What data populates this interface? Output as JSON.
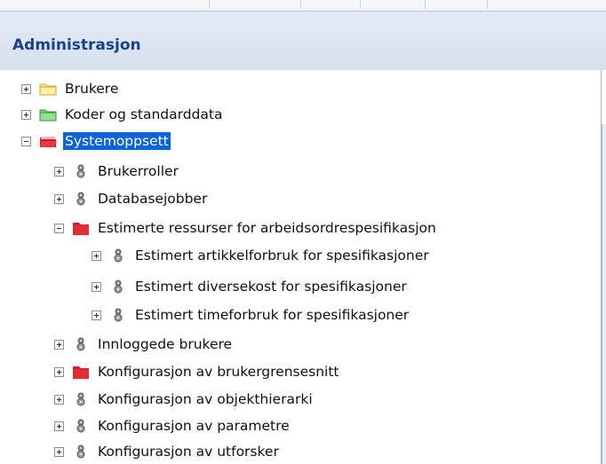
{
  "header": {
    "title": "Administrasjon"
  },
  "tree": {
    "items": [
      {
        "label": "Brukere",
        "state": "collapsed",
        "icon": "folder-yellow-icon"
      },
      {
        "label": "Koder og standarddata",
        "state": "collapsed",
        "icon": "folder-green-icon"
      },
      {
        "label": "Systemoppsett",
        "state": "expanded",
        "icon": "folder-red-open-icon",
        "selected": true
      },
      {
        "label": "Brukerroller",
        "state": "collapsed",
        "icon": "gear-icon"
      },
      {
        "label": "Databasejobber",
        "state": "collapsed",
        "icon": "gear-icon"
      },
      {
        "label": "Estimerte ressurser for arbeidsordrespesifikasjon",
        "state": "expanded",
        "icon": "folder-red-icon"
      },
      {
        "label": "Estimert artikkelforbruk for spesifikasjoner",
        "state": "collapsed",
        "icon": "gear-icon"
      },
      {
        "label": "Estimert diversekost for spesifikasjoner",
        "state": "collapsed",
        "icon": "gear-icon"
      },
      {
        "label": "Estimert timeforbruk for spesifikasjoner",
        "state": "collapsed",
        "icon": "gear-icon"
      },
      {
        "label": "Innloggede brukere",
        "state": "collapsed",
        "icon": "gear-icon"
      },
      {
        "label": "Konfigurasjon av brukergrensesnitt",
        "state": "collapsed",
        "icon": "folder-red-icon"
      },
      {
        "label": "Konfigurasjon av objekthierarki",
        "state": "collapsed",
        "icon": "gear-icon"
      },
      {
        "label": "Konfigurasjon av parametre",
        "state": "collapsed",
        "icon": "gear-icon"
      },
      {
        "label": "Konfigurasjon av utforsker",
        "state": "collapsed",
        "icon": "gear-icon"
      }
    ]
  }
}
